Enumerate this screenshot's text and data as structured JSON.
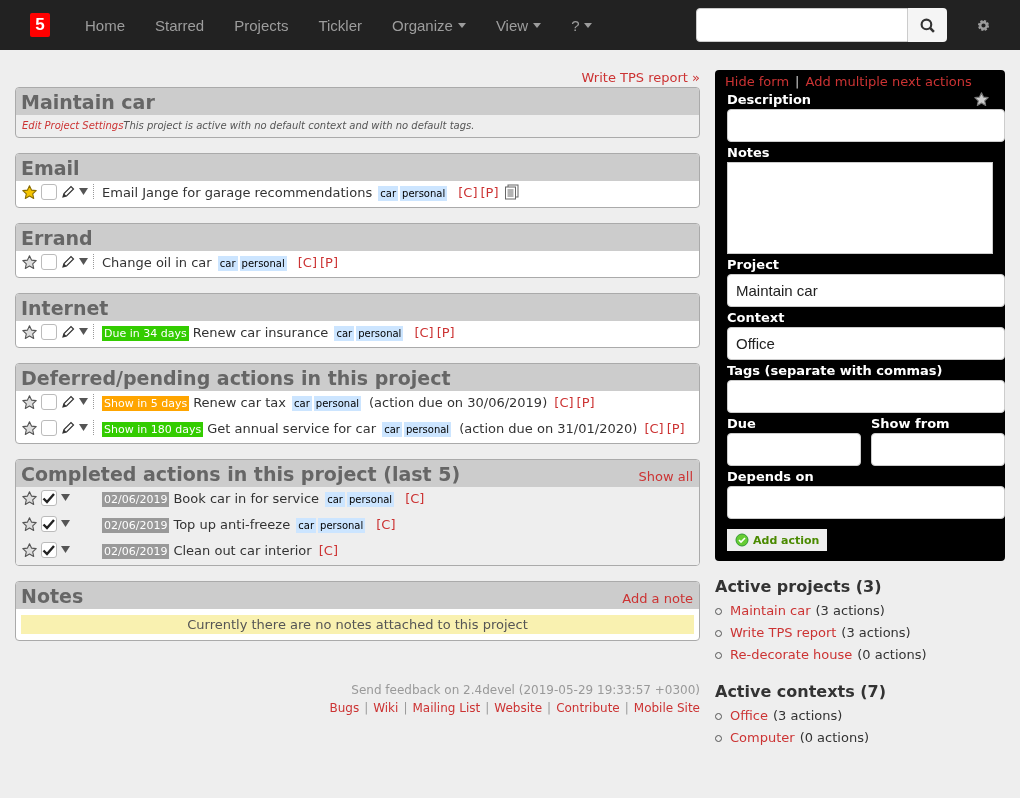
{
  "navbar": {
    "logo": "5",
    "items": [
      {
        "label": "Home",
        "dropdown": false
      },
      {
        "label": "Starred",
        "dropdown": false
      },
      {
        "label": "Projects",
        "dropdown": false
      },
      {
        "label": "Tickler",
        "dropdown": false
      },
      {
        "label": "Organize",
        "dropdown": true
      },
      {
        "label": "View",
        "dropdown": true
      },
      {
        "label": "?",
        "dropdown": true
      }
    ]
  },
  "top_link": "Write TPS report »",
  "project": {
    "title": "Maintain car",
    "settings_link": "Edit Project Settings",
    "description": "This project is active with no default context and with no default tags."
  },
  "sections": [
    {
      "title": "Email",
      "kind": "context",
      "actions": [
        {
          "starred": true,
          "done": false,
          "description": "Email Jange for garage recommendations",
          "tags": [
            "car",
            "personal"
          ],
          "links": [
            "[C]",
            "[P]"
          ],
          "has_notes": true
        }
      ]
    },
    {
      "title": "Errand",
      "kind": "context",
      "actions": [
        {
          "starred": false,
          "done": false,
          "description": "Change oil in car",
          "tags": [
            "car",
            "personal"
          ],
          "links": [
            "[C]",
            "[P]"
          ],
          "has_notes": false
        }
      ]
    },
    {
      "title": "Internet",
      "kind": "context",
      "actions": [
        {
          "starred": false,
          "done": false,
          "badge": {
            "text": "Due in 34 days",
            "color": "#33cc00"
          },
          "description": "Renew car insurance",
          "tags": [
            "car",
            "personal"
          ],
          "links": [
            "[C]",
            "[P]"
          ],
          "has_notes": false
        }
      ]
    },
    {
      "title": "Deferred/pending actions in this project",
      "kind": "context",
      "actions": [
        {
          "starred": false,
          "done": false,
          "badge": {
            "text": "Show in 5 days",
            "color": "#ffa500"
          },
          "description": "Renew car tax",
          "tags": [
            "car",
            "personal"
          ],
          "note": "(action due on 30/06/2019)",
          "links": [
            "[C]",
            "[P]"
          ],
          "has_notes": false
        },
        {
          "starred": false,
          "done": false,
          "badge": {
            "text": "Show in 180 days",
            "color": "#33cc00"
          },
          "description": "Get annual service for car",
          "tags": [
            "car",
            "personal"
          ],
          "note": "(action due on 31/01/2020)",
          "links": [
            "[C]",
            "[P]"
          ],
          "has_notes": false
        }
      ]
    },
    {
      "title": "Completed actions in this project (last 5)",
      "kind": "completed",
      "header_link": "Show all",
      "actions": [
        {
          "starred": false,
          "done": true,
          "badge": {
            "text": "02/06/2019",
            "color": "#999999"
          },
          "description": "Book car in for service",
          "tags": [
            "car",
            "personal"
          ],
          "links": [
            "[C]"
          ],
          "has_notes": false
        },
        {
          "starred": false,
          "done": true,
          "badge": {
            "text": "02/06/2019",
            "color": "#999999"
          },
          "description": "Top up anti-freeze",
          "tags": [
            "car",
            "personal"
          ],
          "links": [
            "[C]"
          ],
          "has_notes": false
        },
        {
          "starred": false,
          "done": true,
          "badge": {
            "text": "02/06/2019",
            "color": "#999999"
          },
          "description": "Clean out car interior",
          "links": [
            "[C]"
          ],
          "has_notes": false
        }
      ]
    }
  ],
  "notes": {
    "title": "Notes",
    "header_link": "Add a note",
    "empty_message": "Currently there are no notes attached to this project"
  },
  "footer": {
    "feedback": "Send feedback on 2.4devel (2019-05-29 19:33:57 +0300)",
    "separator": "|",
    "links": [
      "Bugs",
      "Wiki",
      "Mailing List",
      "Website",
      "Contribute",
      "Mobile Site"
    ]
  },
  "form": {
    "links": [
      "Hide form",
      "Add multiple next actions"
    ],
    "separator": "|",
    "fields": [
      {
        "label": "Description",
        "kind": "text",
        "starrable": true
      },
      {
        "label": "Notes",
        "kind": "textarea"
      },
      {
        "label": "Project",
        "kind": "text",
        "value": "Maintain car"
      },
      {
        "label": "Context",
        "kind": "text",
        "value": "Office"
      },
      {
        "label": "Tags (separate with commas)",
        "kind": "text"
      },
      {
        "label": "Due",
        "kind": "half"
      },
      {
        "label": "Show from",
        "kind": "half"
      },
      {
        "label": "Depends on",
        "kind": "text"
      }
    ],
    "button": "Add action"
  },
  "lists": [
    {
      "title": "Active projects (3)",
      "items": [
        {
          "name": "Maintain car",
          "count": "(3 actions)"
        },
        {
          "name": "Write TPS report",
          "count": "(3 actions)"
        },
        {
          "name": "Re-decorate house",
          "count": "(0 actions)"
        }
      ]
    },
    {
      "title": "Active contexts (7)",
      "items": [
        {
          "name": "Office",
          "count": "(3 actions)"
        },
        {
          "name": "Computer",
          "count": "(0 actions)"
        }
      ]
    }
  ]
}
